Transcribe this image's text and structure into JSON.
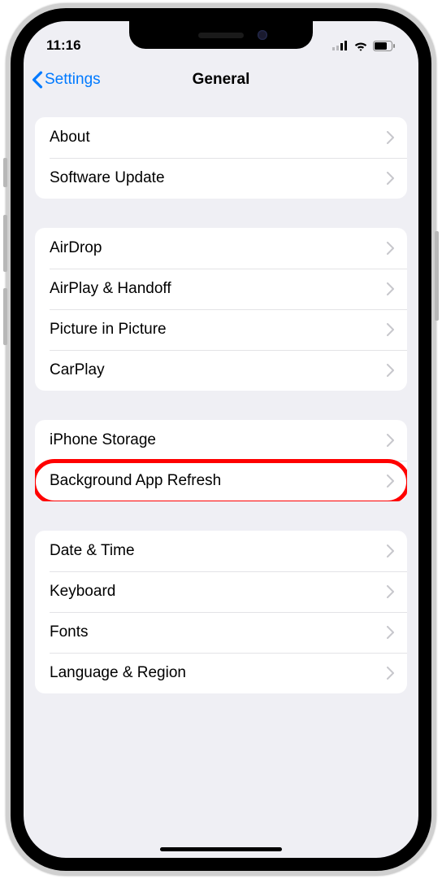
{
  "status": {
    "time": "11:16"
  },
  "nav": {
    "back_label": "Settings",
    "title": "General"
  },
  "groups": [
    {
      "items": [
        {
          "id": "about",
          "label": "About"
        },
        {
          "id": "software-update",
          "label": "Software Update"
        }
      ]
    },
    {
      "items": [
        {
          "id": "airdrop",
          "label": "AirDrop"
        },
        {
          "id": "airplay-handoff",
          "label": "AirPlay & Handoff"
        },
        {
          "id": "picture-in-picture",
          "label": "Picture in Picture"
        },
        {
          "id": "carplay",
          "label": "CarPlay"
        }
      ]
    },
    {
      "items": [
        {
          "id": "iphone-storage",
          "label": "iPhone Storage"
        },
        {
          "id": "background-app-refresh",
          "label": "Background App Refresh",
          "highlighted": true
        }
      ]
    },
    {
      "items": [
        {
          "id": "date-time",
          "label": "Date & Time"
        },
        {
          "id": "keyboard",
          "label": "Keyboard"
        },
        {
          "id": "fonts",
          "label": "Fonts"
        },
        {
          "id": "language-region",
          "label": "Language & Region"
        }
      ]
    }
  ],
  "colors": {
    "accent": "#007aff",
    "highlight": "#ff0000"
  }
}
